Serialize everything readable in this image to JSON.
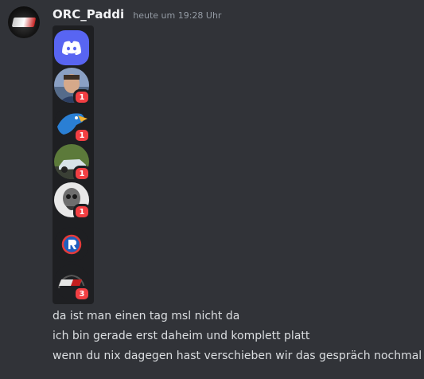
{
  "message": {
    "author": "ORC_Paddi",
    "timestamp": "heute um 19:28 Uhr",
    "lines": [
      "da ist man einen tag msl nicht da",
      "ich bin gerade erst daheim und komplett platt",
      "wenn du nix dagegen hast verschieben wir das gespräch nochmal"
    ]
  },
  "server_list": [
    {
      "icon": "discord-logo-icon",
      "badge": null
    },
    {
      "icon": "person-avatar-icon",
      "badge": "1"
    },
    {
      "icon": "eagle-icon",
      "badge": "1"
    },
    {
      "icon": "car-icon",
      "badge": "1"
    },
    {
      "icon": "skull-face-icon",
      "badge": "1"
    },
    {
      "icon": "r-logo-icon",
      "badge": null
    },
    {
      "icon": "orc-logo-icon",
      "badge": "3"
    }
  ],
  "colors": {
    "background": "#313338",
    "strip": "#1e1f22",
    "blurple": "#5865f2",
    "badge": "#f23f43"
  }
}
